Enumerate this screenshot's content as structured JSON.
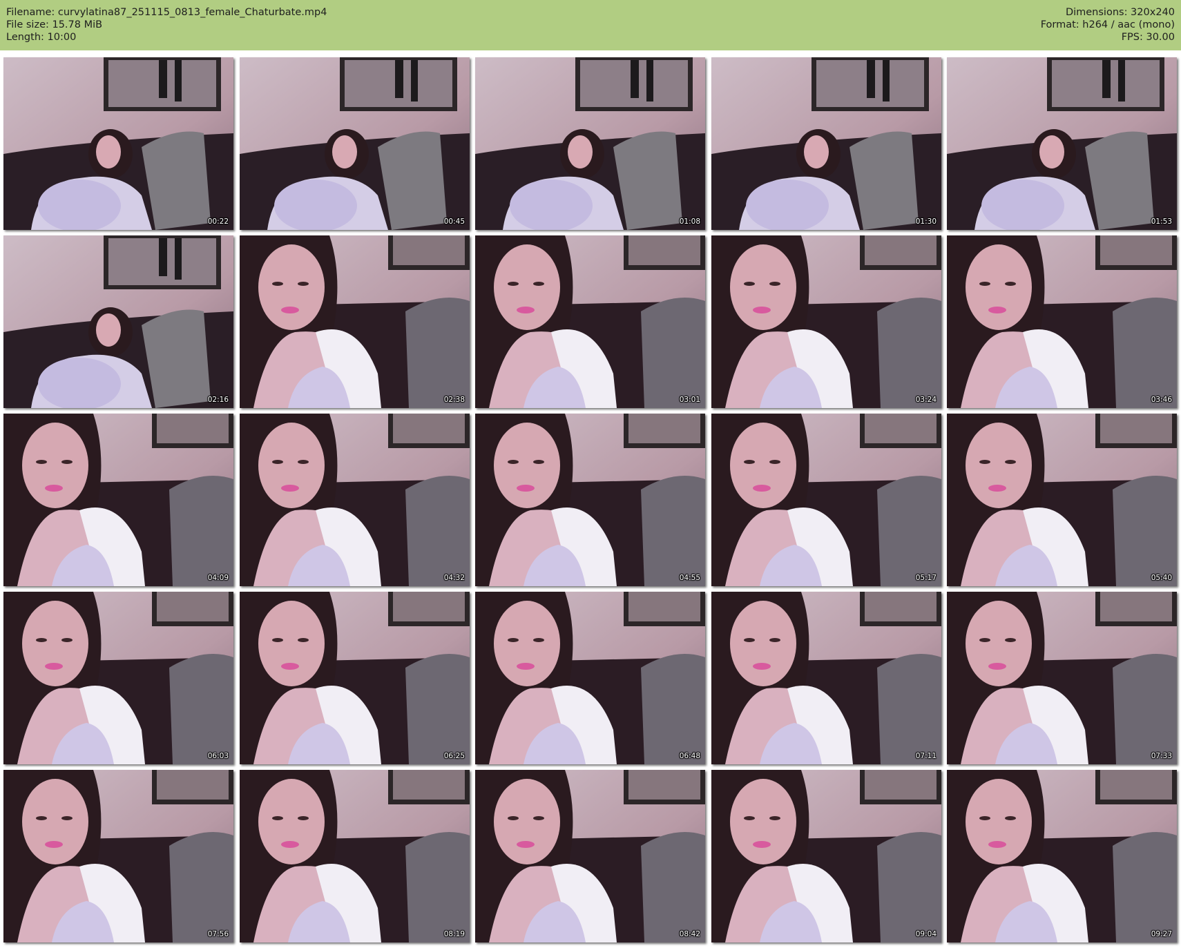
{
  "header": {
    "filename_line": "Filename: curvylatina87_251115_0813_female_Chaturbate.mp4",
    "filesize_line": "File size: 15.78 MiB",
    "length_line": "Length: 10:00",
    "dimensions_line": "Dimensions: 320x240",
    "format_line": "Format: h264 / aac (mono)",
    "fps_line": "FPS: 30.00",
    "background_color": "#b1cd82"
  },
  "thumbnails": [
    {
      "timestamp": "00:22",
      "scene": "wide"
    },
    {
      "timestamp": "00:45",
      "scene": "wide"
    },
    {
      "timestamp": "01:08",
      "scene": "wide"
    },
    {
      "timestamp": "01:30",
      "scene": "wide"
    },
    {
      "timestamp": "01:53",
      "scene": "wide"
    },
    {
      "timestamp": "02:16",
      "scene": "wide"
    },
    {
      "timestamp": "02:38",
      "scene": "close"
    },
    {
      "timestamp": "03:01",
      "scene": "close"
    },
    {
      "timestamp": "03:24",
      "scene": "close"
    },
    {
      "timestamp": "03:46",
      "scene": "close"
    },
    {
      "timestamp": "04:09",
      "scene": "close"
    },
    {
      "timestamp": "04:32",
      "scene": "close"
    },
    {
      "timestamp": "04:55",
      "scene": "close"
    },
    {
      "timestamp": "05:17",
      "scene": "close"
    },
    {
      "timestamp": "05:40",
      "scene": "close"
    },
    {
      "timestamp": "06:03",
      "scene": "close"
    },
    {
      "timestamp": "06:25",
      "scene": "close"
    },
    {
      "timestamp": "06:48",
      "scene": "close"
    },
    {
      "timestamp": "07:11",
      "scene": "close"
    },
    {
      "timestamp": "07:33",
      "scene": "close"
    },
    {
      "timestamp": "07:56",
      "scene": "close"
    },
    {
      "timestamp": "08:19",
      "scene": "close"
    },
    {
      "timestamp": "08:42",
      "scene": "close"
    },
    {
      "timestamp": "09:04",
      "scene": "close"
    },
    {
      "timestamp": "09:27",
      "scene": "close"
    }
  ]
}
